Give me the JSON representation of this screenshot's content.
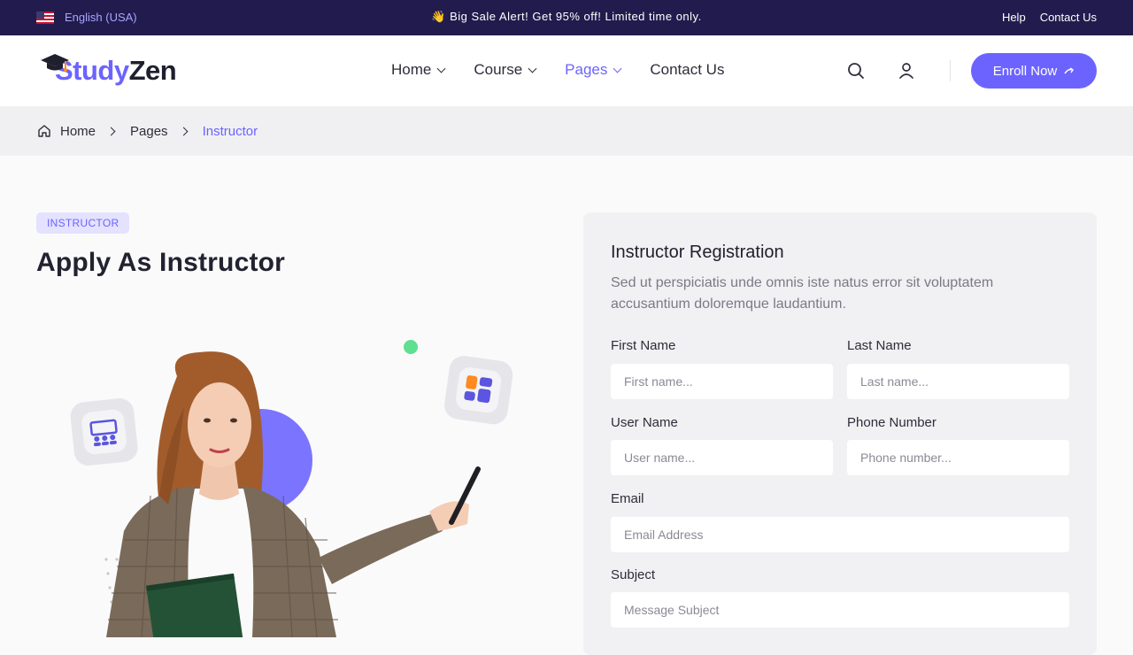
{
  "topbar": {
    "language": "English (USA)",
    "promo": "👋 Big Sale Alert! Get 95% off! Limited time only.",
    "links": [
      "Help",
      "Contact Us"
    ]
  },
  "header": {
    "logo_part1": "Study",
    "logo_part2": "Zen",
    "nav": [
      {
        "label": "Home"
      },
      {
        "label": "Course"
      },
      {
        "label": "Pages"
      },
      {
        "label": "Contact Us"
      }
    ],
    "enroll_label": "Enroll Now"
  },
  "breadcrumb": [
    "Home",
    "Pages",
    "Instructor"
  ],
  "hero": {
    "tag": "INSTRUCTOR",
    "title": "Apply As Instructor"
  },
  "form": {
    "title": "Instructor Registration",
    "description": "Sed ut perspiciatis unde omnis iste natus error sit voluptatem accusantium doloremque laudantium.",
    "first_name": {
      "label": "First Name",
      "placeholder": "First name..."
    },
    "last_name": {
      "label": "Last Name",
      "placeholder": "Last name..."
    },
    "user_name": {
      "label": "User Name",
      "placeholder": "User name..."
    },
    "phone": {
      "label": "Phone Number",
      "placeholder": "Phone number..."
    },
    "email": {
      "label": "Email",
      "placeholder": "Email Address"
    },
    "subject": {
      "label": "Subject",
      "placeholder": "Message Subject"
    }
  },
  "colors": {
    "accent": "#6c63ff",
    "topbar_bg": "#211c4d",
    "green_dot": "#5ee08f",
    "orange": "#ff8a1f"
  }
}
